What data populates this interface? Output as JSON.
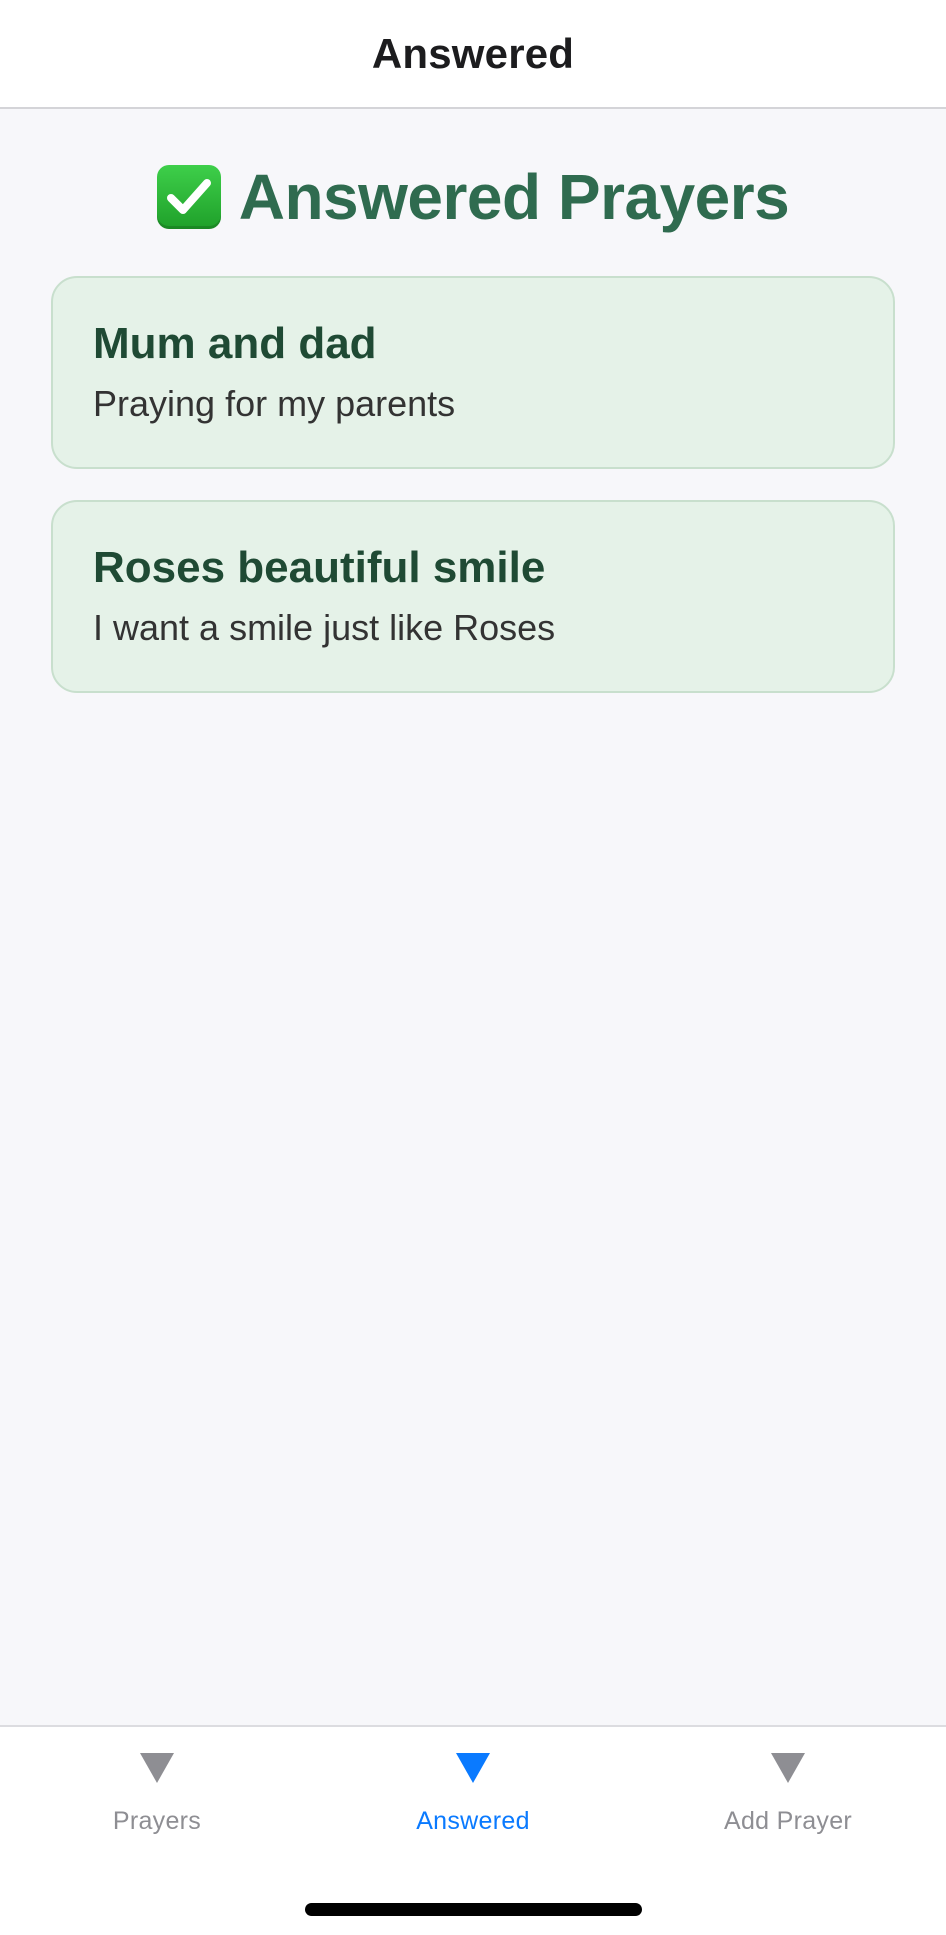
{
  "header": {
    "title": "Answered"
  },
  "page": {
    "heading_icon": "white-check-mark-emoji",
    "heading": "Answered Prayers"
  },
  "prayers": [
    {
      "title": "Mum and dad",
      "description": "Praying for my parents"
    },
    {
      "title": "Roses beautiful smile",
      "description": "I want a smile just like Roses"
    }
  ],
  "tab_bar": {
    "tabs": [
      {
        "label": "Prayers",
        "icon": "triangle-down-icon",
        "active": false
      },
      {
        "label": "Answered",
        "icon": "triangle-down-icon",
        "active": true
      },
      {
        "label": "Add Prayer",
        "icon": "triangle-down-icon",
        "active": false
      }
    ]
  },
  "colors": {
    "accent": "#0a7aff",
    "heading_green": "#2f6b4f",
    "card_background": "#e5f2e8",
    "inactive_tab": "#8e8e93"
  }
}
